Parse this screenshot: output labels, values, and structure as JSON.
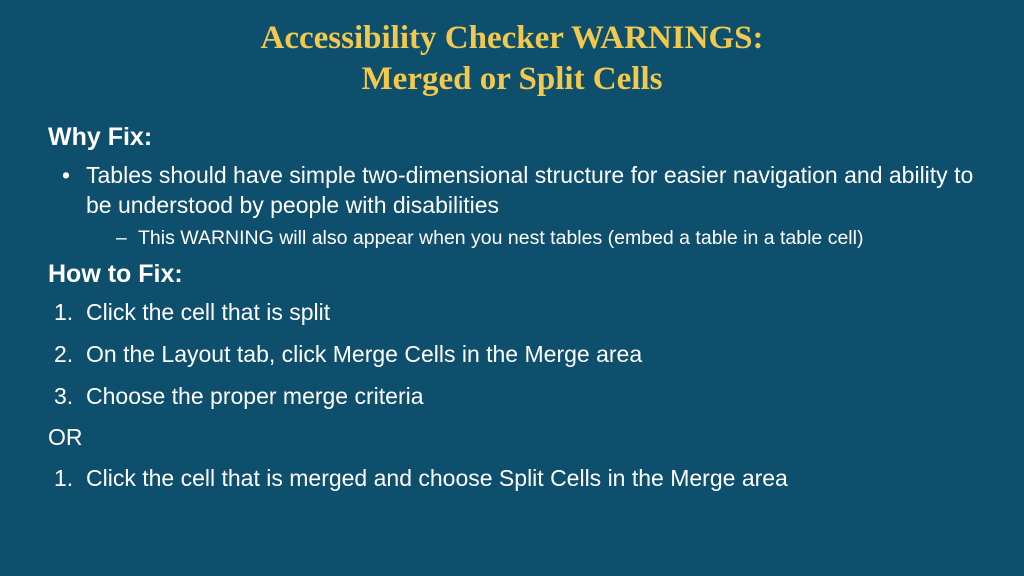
{
  "title": {
    "line1": "Accessibility Checker WARNINGS:",
    "line2": "Merged or Split Cells"
  },
  "sections": {
    "whyFix": {
      "heading": "Why Fix:",
      "bullet": "Tables should have simple two-dimensional structure for easier navigation and ability to be understood by people with disabilities",
      "subBullet": "This WARNING will also appear when you nest tables (embed a table in a table cell)"
    },
    "howToFix": {
      "heading": "How to Fix:",
      "steps1": {
        "s1": "Click the cell that is split",
        "s2": "On the Layout tab, click Merge Cells in the Merge area",
        "s3": "Choose the proper merge criteria"
      },
      "or": "OR",
      "steps2": {
        "s1": "Click the cell that is merged and choose Split Cells in the Merge area"
      }
    }
  }
}
